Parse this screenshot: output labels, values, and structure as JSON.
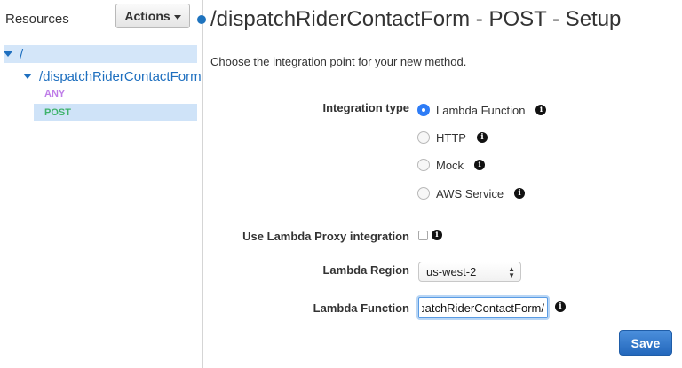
{
  "sidebar": {
    "title": "Resources",
    "actions_label": "Actions",
    "tree": {
      "root": "/",
      "resource": "/dispatchRiderContactForm",
      "methods": [
        "ANY",
        "POST"
      ]
    }
  },
  "main": {
    "title": "/dispatchRiderContactForm - POST - Setup",
    "intro": "Choose the integration point for your new method.",
    "integration_type_label": "Integration type",
    "integration_options": [
      "Lambda Function",
      "HTTP",
      "Mock",
      "AWS Service"
    ],
    "selected_integration": "Lambda Function",
    "proxy_label": "Use Lambda Proxy integration",
    "proxy_checked": false,
    "region_label": "Lambda Region",
    "region_value": "us-west-2",
    "function_label": "Lambda Function",
    "function_value": "/dispatchRiderContactForm",
    "save_label": "Save"
  },
  "colors": {
    "accent": "#1e73be",
    "link": "#1e6fbf",
    "method_any": "#bf7de8",
    "method_post": "#3fb36c",
    "selected_row": "#d4e6f9",
    "save_button": "#2468bc"
  },
  "icons": {
    "info": "info-icon",
    "expand": "caret-down-icon",
    "select": "up-down-arrows-icon"
  }
}
